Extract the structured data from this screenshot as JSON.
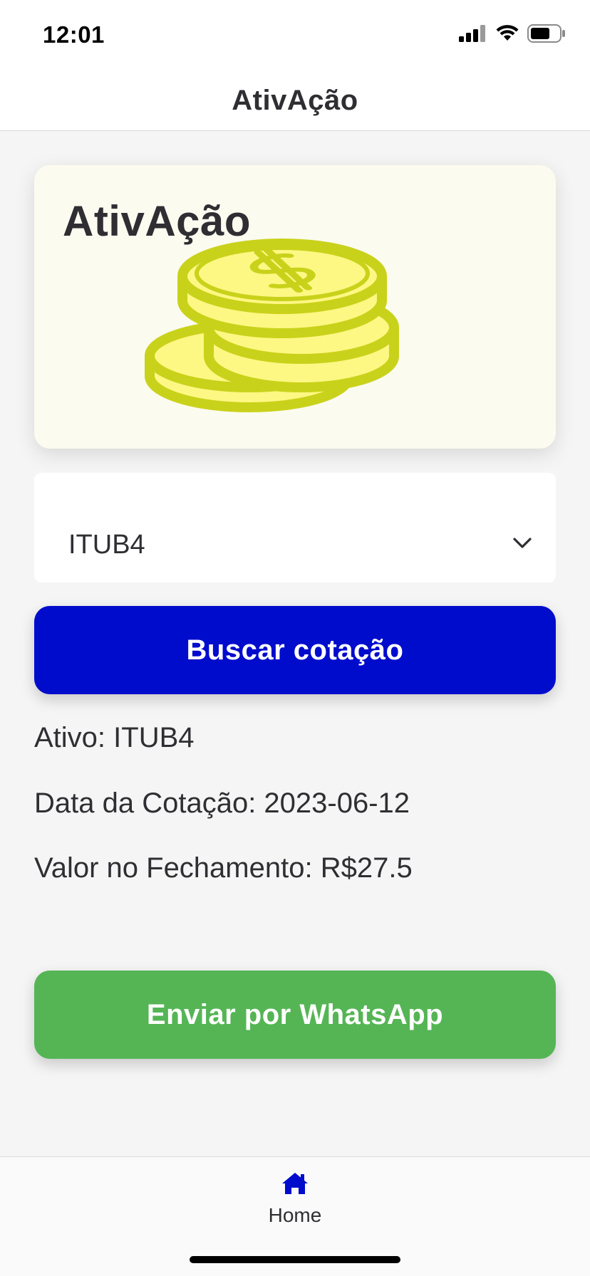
{
  "status_bar": {
    "time": "12:01",
    "icons": [
      "cellular-signal-icon",
      "wifi-icon",
      "battery-icon"
    ]
  },
  "header": {
    "title": "AtivAção"
  },
  "hero": {
    "title": "AtivAção",
    "illustration": "coins-dollar-icon",
    "colors": {
      "coin_fill": "#fdf783",
      "coin_stroke": "#c9d21a",
      "card_bg": "#fbfbef"
    }
  },
  "asset_select": {
    "selected_value": "ITUB4",
    "icon": "chevron-down-icon"
  },
  "search_button": {
    "label": "Buscar cotação",
    "color": "#000ccc"
  },
  "results": {
    "asset_line": "Ativo: ITUB4",
    "date_line": "Data da Cotação: 2023-06-12",
    "close_value_line": "Valor no Fechamento: R$27.5"
  },
  "whatsapp_button": {
    "label": "Enviar por WhatsApp",
    "color": "#55b555"
  },
  "tab_bar": {
    "items": [
      {
        "label": "Home",
        "icon": "home-icon",
        "active": true,
        "color": "#000ccc"
      }
    ]
  }
}
